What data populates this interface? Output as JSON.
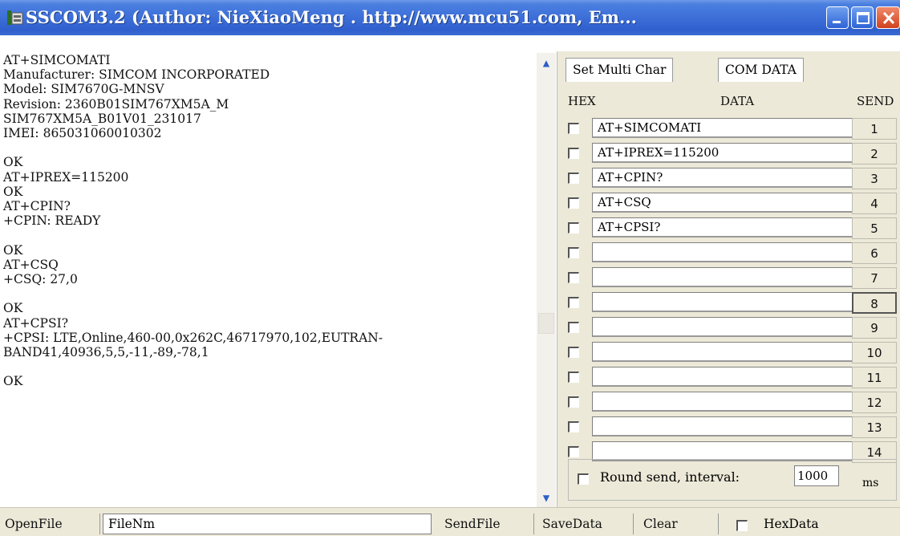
{
  "window": {
    "title": "SSCOM3.2 (Author: NieXiaoMeng . http://www.mcu51.com, Em...",
    "icon": "serial-port-app-icon"
  },
  "receive": {
    "text": "AT+SIMCOMATI\nManufacturer: SIMCOM INCORPORATED\nModel: SIM7670G-MNSV\nRevision: 2360B01SIM767XM5A_M\nSIM767XM5A_B01V01_231017\nIMEI: 865031060010302\n\nOK\nAT+IPREX=115200\nOK\nAT+CPIN?\n+CPIN: READY\n\nOK\nAT+CSQ\n+CSQ: 27,0\n\nOK\nAT+CPSI?\n+CPSI: LTE,Online,460-00,0x262C,46717970,102,EUTRAN-\nBAND41,40936,5,5,-11,-89,-78,1\n\nOK"
  },
  "tabs": [
    {
      "label": "Set Multi Char"
    },
    {
      "label": "COM DATA"
    }
  ],
  "multi": {
    "hex_header": "HEX",
    "data_header": "DATA",
    "send_header": "SEND",
    "rows": [
      {
        "data": "AT+SIMCOMATI",
        "send": "1"
      },
      {
        "data": "AT+IPREX=115200",
        "send": "2"
      },
      {
        "data": "AT+CPIN?",
        "send": "3"
      },
      {
        "data": "AT+CSQ",
        "send": "4"
      },
      {
        "data": "AT+CPSI?",
        "send": "5"
      },
      {
        "data": "",
        "send": "6"
      },
      {
        "data": "",
        "send": "7"
      },
      {
        "data": "",
        "send": "8"
      },
      {
        "data": "",
        "send": "9"
      },
      {
        "data": "",
        "send": "10"
      },
      {
        "data": "",
        "send": "11"
      },
      {
        "data": "",
        "send": "12"
      },
      {
        "data": "",
        "send": "13"
      },
      {
        "data": "",
        "send": "14"
      }
    ],
    "round_send_label": "Round send, interval:",
    "interval_value": "1000",
    "ms_label": "ms"
  },
  "toolbar": {
    "openfile_label": "OpenFile",
    "filename_value": "FileNm",
    "sendfile_label": "SendFile",
    "savedata_label": "SaveData",
    "clear_label": "Clear",
    "hexdata_label": "HexData"
  }
}
